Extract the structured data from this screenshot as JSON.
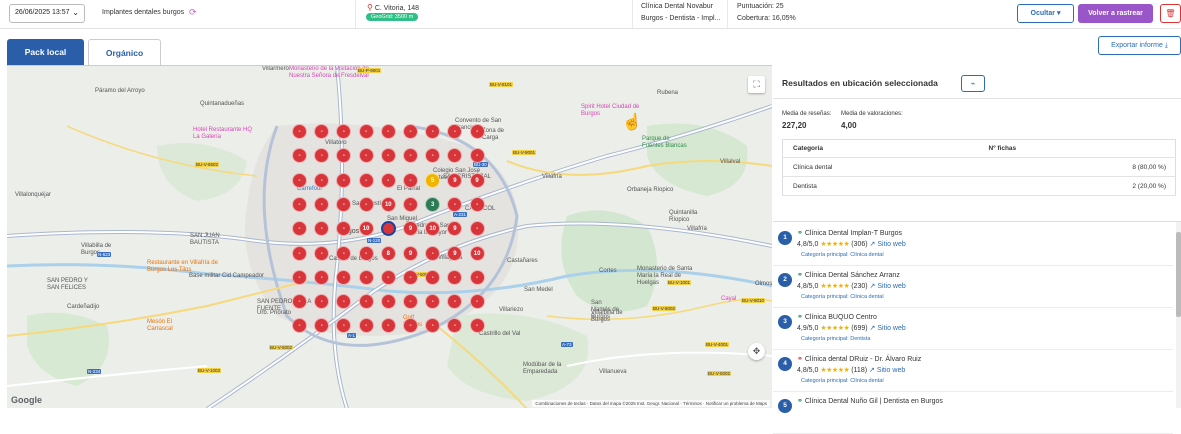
{
  "topbar": {
    "date": "26/06/2025 13:57",
    "keyword": "Implantes dentales burgos",
    "address": "C. Vitoria, 148",
    "geogrid_badge": "GeoGrid: 3500 m",
    "business_name": "Clínica Dental Novabur",
    "business_category": "Burgos - Dentista - Impl...",
    "score": "Puntuación: 25",
    "coverage": "Cobertura: 16,05%",
    "hide_label": "Ocultar",
    "retrack_label": "Volver a rastrear",
    "delete_icon": "trash-icon"
  },
  "tabs": [
    {
      "label": "Pack local",
      "active": true
    },
    {
      "label": "Orgánico",
      "active": false
    }
  ],
  "export_label": "Exportar informe",
  "map": {
    "labels": [
      {
        "text": "Villarmero",
        "cls": ""
      },
      {
        "text": "Monasterio de la Visitación de Nuestra Señora de Fresdelval",
        "cls": "poi-pink"
      },
      {
        "text": "Páramo del Arroyo",
        "cls": ""
      },
      {
        "text": "Quintanadueñas",
        "cls": ""
      },
      {
        "text": "Hotel Restaurante HQ La Galería",
        "cls": "poi-pink"
      },
      {
        "text": "Villatoro",
        "cls": ""
      },
      {
        "text": "Convento de San Francisco",
        "cls": ""
      },
      {
        "text": "Colegio San José Artesano",
        "cls": ""
      },
      {
        "text": "Spirit Hotel Ciudad de Burgos",
        "cls": "poi-pink"
      },
      {
        "text": "Rubena",
        "cls": ""
      },
      {
        "text": "Carrefour",
        "cls": "poi-blue"
      },
      {
        "text": "SAN CRISTÓBAL",
        "cls": ""
      },
      {
        "text": "Villafría",
        "cls": ""
      },
      {
        "text": "Villalval",
        "cls": ""
      },
      {
        "text": "Villalonquéjar",
        "cls": ""
      },
      {
        "text": "Orbaneja Riopico",
        "cls": ""
      },
      {
        "text": "Quintanilla Ríopico",
        "cls": ""
      },
      {
        "text": "CAPISCOL",
        "cls": ""
      },
      {
        "text": "SAN JUAN BAUTISTA",
        "cls": ""
      },
      {
        "text": "Burgos",
        "cls": "big"
      },
      {
        "text": "Villabilla de Burgos",
        "cls": ""
      },
      {
        "text": "Restaurante en Villafría de Burgos Los Tilos",
        "cls": "poi-orange"
      },
      {
        "text": "Catedral de Santa María la Mayor",
        "cls": ""
      },
      {
        "text": "Villayuda",
        "cls": ""
      },
      {
        "text": "Castañares",
        "cls": ""
      },
      {
        "text": "Monasterio de Santa María la Real de Huelgas",
        "cls": ""
      },
      {
        "text": "Base militar Cid Campeador",
        "cls": ""
      },
      {
        "text": "Cortes",
        "cls": ""
      },
      {
        "text": "Golf Burgos",
        "cls": "poi-orange"
      },
      {
        "text": "San Medel",
        "cls": ""
      },
      {
        "text": "San Mamés de Burgos",
        "cls": ""
      },
      {
        "text": "SAN PEDRO Y SAN FELICES",
        "cls": ""
      },
      {
        "text": "SAN PEDRO DE LA FUENTE",
        "cls": ""
      },
      {
        "text": "Urb. Priorato",
        "cls": ""
      },
      {
        "text": "Villalbilla de Burgos",
        "cls": ""
      },
      {
        "text": "Cardeñadijo",
        "cls": ""
      },
      {
        "text": "Villariezo",
        "cls": ""
      },
      {
        "text": "Mesón El Carrascal",
        "cls": "poi-orange"
      },
      {
        "text": "Castrillo del Val",
        "cls": ""
      },
      {
        "text": "Modúbar de la Emparedada",
        "cls": ""
      },
      {
        "text": "Villanueva",
        "cls": ""
      },
      {
        "text": "Cayal",
        "cls": "poi-pink"
      },
      {
        "text": "Olmos",
        "cls": ""
      },
      {
        "text": "Zona de Carga",
        "cls": ""
      },
      {
        "text": "San Miguel",
        "cls": ""
      },
      {
        "text": "El Parral",
        "cls": ""
      },
      {
        "text": "Castillo de Burgos",
        "cls": ""
      },
      {
        "text": "Parque de Fuentes Blancas",
        "cls": "poi-green"
      },
      {
        "text": "San Agustín",
        "cls": ""
      },
      {
        "text": "Villafría",
        "cls": ""
      }
    ],
    "road_badges": [
      "BU-V-8101",
      "BU-P-9001",
      "BU-V-6502",
      "A-231",
      "A-1",
      "BU-30",
      "N-120",
      "N-623",
      "BU-V-8002",
      "BU-V-5002",
      "A-73",
      "N-234",
      "BU-V-1001",
      "BU-V-4001",
      "BU-V-1003",
      "BU-V-5002",
      "BU-V-8001",
      "BU-V-5002",
      "BU-V-8010"
    ],
    "google_text": "Google",
    "attribution": "Combinaciones de teclas · Datos del mapa ©2025 Inst. Geogr. Nacional · Términos · Notificar un problema de Maps",
    "grid_rows": [
      [
        "-",
        "-",
        "-",
        "-",
        "-",
        "-",
        "-",
        "-",
        "-"
      ],
      [
        "-",
        "-",
        "-",
        "-",
        "-",
        "-",
        "-",
        "-",
        "-"
      ],
      [
        "-",
        "-",
        "-",
        "-",
        "-",
        "-",
        "5",
        "9",
        "9"
      ],
      [
        "-",
        "-",
        "-",
        "-",
        "10",
        "-",
        "3",
        "-",
        "-"
      ],
      [
        "-",
        "-",
        "-",
        "10",
        "",
        "9",
        "10",
        "9",
        "-"
      ],
      [
        "-",
        "-",
        "-",
        "-",
        "8",
        "9",
        "-",
        "9",
        "10"
      ],
      [
        "-",
        "-",
        "-",
        "-",
        "-",
        "-",
        "-",
        "-",
        "-"
      ],
      [
        "-",
        "-",
        "-",
        "-",
        "-",
        "-",
        "-",
        "-",
        "-"
      ],
      [
        "-",
        "-",
        "-",
        "-",
        "-",
        "-",
        "-",
        "-",
        "-"
      ]
    ],
    "dot_colors": {
      "default": "#d8353a",
      "5": "#f0b400",
      "3": "#2c7a56"
    }
  },
  "results": {
    "title": "Resultados en ubicación seleccionada",
    "reviews_label": "Media de reseñas:",
    "reviews_value": "227,20",
    "ratings_label": "Media de valoraciones:",
    "ratings_value": "4,00",
    "table_headers": [
      "Categoría",
      "Nº fichas"
    ],
    "table_rows": [
      [
        "Clínica dental",
        "8 (80,00 %)"
      ],
      [
        "Dentista",
        "2 (20,00 %)"
      ]
    ],
    "list": [
      {
        "rank": "1",
        "name": "Clínica Dental Implan-T Burgos",
        "rating": "4,8/5,0",
        "stars": "★★★★★",
        "reviews": "(306)",
        "web": "Sitio web",
        "category": "Categoría principal: Clínica dental"
      },
      {
        "rank": "2",
        "name": "Clínica Dental Sánchez Arranz",
        "rating": "4,8/5,0",
        "stars": "★★★★★",
        "reviews": "(230)",
        "web": "Sitio web",
        "category": "Categoría principal: Clínica dental"
      },
      {
        "rank": "3",
        "name": "Clínica BUQUO Centro",
        "rating": "4,9/5,0",
        "stars": "★★★★★",
        "reviews": "(699)",
        "web": "Sitio web",
        "category": "Categoría principal: Dentista"
      },
      {
        "rank": "4",
        "name": "Clínica dental DRuiz - Dr. Álvaro Ruiz",
        "rating": "4,8/5,0",
        "stars": "★★★★★",
        "reviews": "(118)",
        "web": "Sitio web",
        "category": "Categoría principal: Clínica dental"
      },
      {
        "rank": "5",
        "name": "Clínica Dental Nuño Gil | Dentista en Burgos",
        "rating": "",
        "stars": "",
        "reviews": "",
        "web": "",
        "category": ""
      }
    ]
  }
}
